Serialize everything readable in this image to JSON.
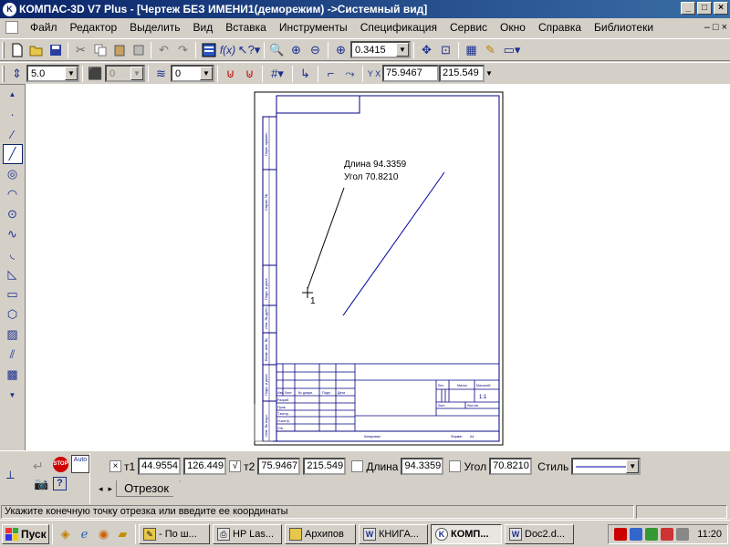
{
  "window": {
    "title": "КОМПАС-3D V7 Plus - [Чертеж БЕЗ ИМЕНИ1(деморежим) ->Системный вид]",
    "app_badge": "K",
    "minimize": "_",
    "maximize": "□",
    "close": "×"
  },
  "menu": {
    "items": [
      "Файл",
      "Редактор",
      "Выделить",
      "Вид",
      "Вставка",
      "Инструменты",
      "Спецификация",
      "Сервис",
      "Окно",
      "Справка",
      "Библиотеки"
    ],
    "mdi_buttons": [
      "–",
      "□",
      "×"
    ]
  },
  "toolbar1": {
    "zoom_value": "0.3415"
  },
  "toolbar2": {
    "step_value": "5.0",
    "disabled_combo": "0",
    "layer_value": "0",
    "cursor_x": "75.9467",
    "cursor_y": "215.549",
    "coord_label": "Y X"
  },
  "drawing": {
    "annotation_length": "Длина 94.3359",
    "annotation_angle": "Угол  70.8210",
    "point_label": "1",
    "side_labels": [
      "Перв. примен.",
      "Справ. №",
      "Подп. и дата",
      "Инв. № дубл.",
      "Взам. инв. №",
      "Подп. и дата",
      "Инв. № подл."
    ],
    "titleblock": {
      "izm": "Изм.",
      "list": "Лист",
      "ndokum": "№ докум.",
      "podp": "Подп.",
      "data": "Дата",
      "razrab": "Разраб.",
      "prov": "Пров.",
      "tkontr": "Т.контр.",
      "nkontr": "Н.контр.",
      "utv": "Утв.",
      "lit": "Лит.",
      "massa": "Масса",
      "masshtab": "Масштаб",
      "scale_value": "1:1",
      "list2": "Лист",
      "listov": "Листов",
      "kopiroval": "Копировал",
      "format": "Формат",
      "format_value": "А4"
    }
  },
  "properties": {
    "t1_label": "т1",
    "t1_x": "44.9554",
    "t1_y": "126.449",
    "t2_label": "т2",
    "t2_check": "√",
    "t2_x": "75.9467",
    "t2_y": "215.549",
    "length_label": "Длина",
    "length_value": "94.3359",
    "angle_label": "Угол",
    "angle_value": "70.8210",
    "style_label": "Стиль",
    "tab_label": "Отрезок",
    "auto_label": "Auto",
    "stop_label": "STOP",
    "help_label": "?"
  },
  "status": {
    "message": "Укажите конечную точку отрезка или введите ее координаты"
  },
  "taskbar": {
    "start_label": "Пуск",
    "tasks": [
      "- По ш...",
      "HP Las...",
      "Архипов",
      "КНИГА...",
      "КОМП...",
      "Doc2.d..."
    ],
    "clock": "11:20"
  },
  "colors": {
    "accent": "#0a246a",
    "drawing_line": "#0000a0",
    "annotation": "#000000"
  }
}
